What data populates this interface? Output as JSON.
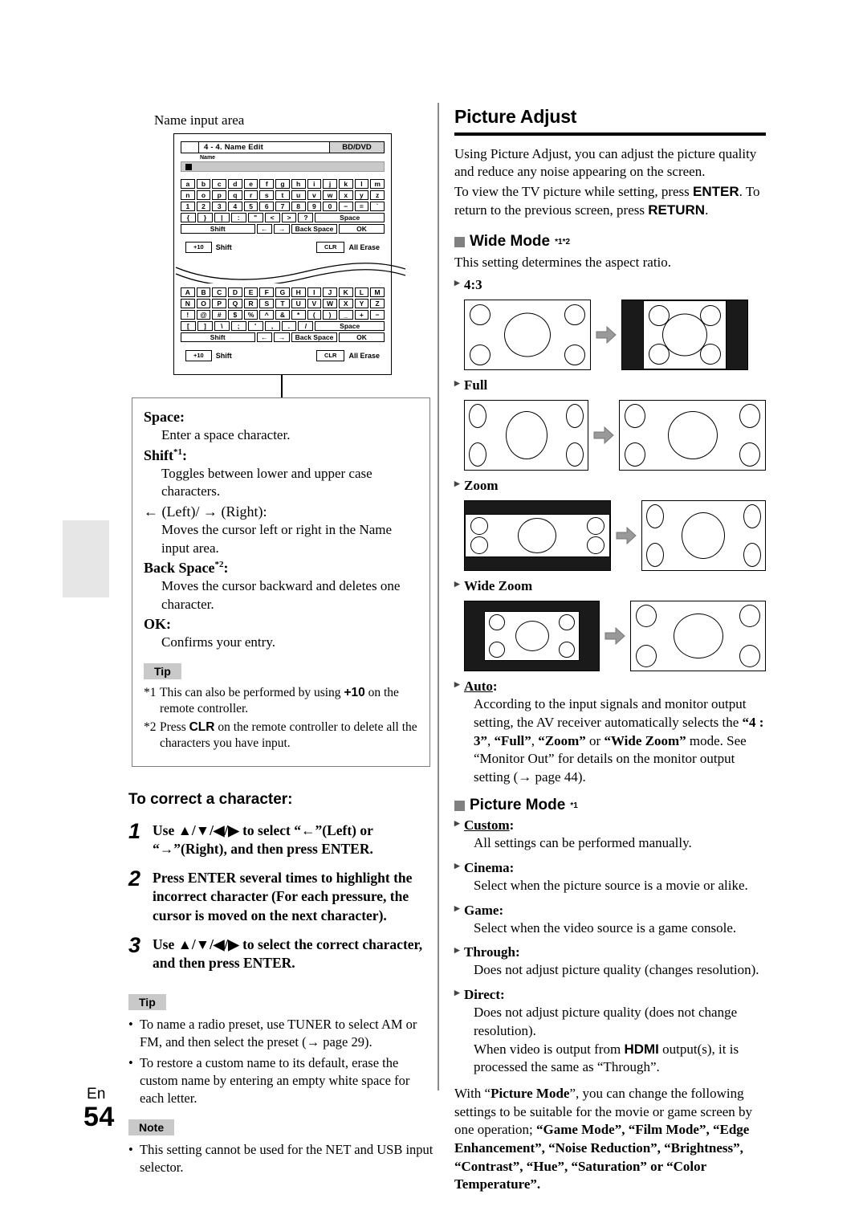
{
  "footer": {
    "lang": "En",
    "page": "54"
  },
  "left": {
    "caption": "Name input area",
    "osd": {
      "title": "4 - 4. Name  Edit",
      "tag": "BD/DVD",
      "name_label": "Name"
    },
    "keyboard_lower": {
      "rows": [
        [
          "a",
          "b",
          "c",
          "d",
          "e",
          "f",
          "g",
          "h",
          "i",
          "j",
          "k",
          "l",
          "m"
        ],
        [
          "n",
          "o",
          "p",
          "q",
          "r",
          "s",
          "t",
          "u",
          "v",
          "w",
          "x",
          "y",
          "z"
        ],
        [
          "1",
          "2",
          "3",
          "4",
          "5",
          "6",
          "7",
          "8",
          "9",
          "0",
          "−",
          "=",
          "`"
        ],
        [
          "{",
          "}",
          "|",
          ":",
          "\"",
          "<",
          ">",
          "?"
        ]
      ],
      "space": "Space",
      "shift": "Shift",
      "left_arrow": "←",
      "right_arrow": "→",
      "back_space": "Back Space",
      "ok": "OK"
    },
    "keyboard_upper": {
      "rows": [
        [
          "A",
          "B",
          "C",
          "D",
          "E",
          "F",
          "G",
          "H",
          "I",
          "J",
          "K",
          "L",
          "M"
        ],
        [
          "N",
          "O",
          "P",
          "Q",
          "R",
          "S",
          "T",
          "U",
          "V",
          "W",
          "X",
          "Y",
          "Z"
        ],
        [
          "!",
          "@",
          "#",
          "$",
          "%",
          "^",
          "&",
          "*",
          "(",
          ")",
          "_",
          "+",
          "−"
        ],
        [
          "[",
          "]",
          "\\",
          ";",
          "'",
          ",",
          ".",
          "/"
        ]
      ],
      "space": "Space",
      "shift": "Shift",
      "left_arrow": "←",
      "right_arrow": "→",
      "back_space": "Back Space",
      "ok": "OK"
    },
    "legend": {
      "plus10": "+10",
      "plus10_label": "Shift",
      "clr": "CLR",
      "clr_label": "All Erase"
    },
    "definitions": {
      "space_term": "Space",
      "space_def": "Enter a space character.",
      "shift_term": "Shift",
      "shift_sup": "*1",
      "shift_def": "Toggles between lower and upper case characters.",
      "arrows_term": "← (Left)/ → (Right):",
      "arrows_def": "Moves the cursor left or right in the Name input area.",
      "back_term": "Back Space",
      "back_sup": "*2",
      "back_def": "Moves the cursor backward and deletes one character.",
      "ok_term": "OK",
      "ok_def": "Confirms your entry."
    },
    "tip_box": {
      "label": "Tip",
      "fn1_mark": "*1",
      "fn1_a": "This can also be performed by using ",
      "fn1_key": "+10",
      "fn1_b": " on the remote controller.",
      "fn2_mark": "*2",
      "fn2_a": "Press ",
      "fn2_key": "CLR",
      "fn2_b": " on the remote controller to delete all the characters you have input."
    },
    "correct": {
      "heading": "To correct a character:",
      "steps": [
        {
          "num": "1",
          "text": "Use ▲/▼/◀/▶ to select “←”(Left) or “→”(Right), and then press ENTER."
        },
        {
          "num": "2",
          "text": "Press ENTER several times to highlight the incorrect character (For each pressure, the cursor is moved on the next character)."
        },
        {
          "num": "3",
          "text": "Use ▲/▼/◀/▶ to select the correct character, and then press ENTER."
        }
      ]
    },
    "tip2": {
      "label": "Tip",
      "items": [
        "To name a radio preset, use TUNER to select AM or FM, and then select the preset (→ page 29).",
        "To restore a custom name to its default, erase the custom name by entering an empty white space for each letter."
      ]
    },
    "note": {
      "label": "Note",
      "items": [
        "This setting cannot be used for the NET and USB input selector."
      ]
    }
  },
  "right": {
    "title": "Picture Adjust",
    "intro_1": "Using Picture Adjust, you can adjust the picture quality and reduce any noise appearing on the screen.",
    "intro_2a": "To view the TV picture while setting, press ",
    "intro_2b": "ENTER",
    "intro_2c": ". To return to the previous screen, press ",
    "intro_2d": "RETURN",
    "intro_2e": ".",
    "wide_mode": {
      "label": "Wide Mode",
      "sup": "*1*2",
      "desc": "This setting determines the aspect ratio."
    },
    "modes": [
      {
        "label": "4:3",
        "diagram": "four-three"
      },
      {
        "label": "Full",
        "diagram": "full"
      },
      {
        "label": "Zoom",
        "diagram": "zoom"
      },
      {
        "label": "Wide Zoom",
        "diagram": "wide-zoom"
      }
    ],
    "auto": {
      "term": "Auto",
      "line1": "According to the input signals and monitor output setting, the AV receiver automatically selects the ",
      "q1": "“4 : 3”",
      "q2": "“Full”",
      "q3": "“Zoom”",
      "q4": "“Wide Zoom”",
      "line2": " mode. See “Monitor Out” for details on the monitor output setting (→ page 44)."
    },
    "picture_mode": {
      "label": "Picture Mode",
      "sup": "*1"
    },
    "picture_modes": [
      {
        "term": "Custom",
        "underline": true,
        "def": "All settings can be performed manually."
      },
      {
        "term": "Cinema",
        "underline": false,
        "def": "Select when the picture source is a movie or alike."
      },
      {
        "term": "Game",
        "underline": false,
        "def": "Select when the video source is a game console."
      },
      {
        "term": "Through",
        "underline": false,
        "def": "Does not adjust picture quality (changes resolution)."
      },
      {
        "term": "Direct",
        "underline": false,
        "def": "Does not adjust picture quality (does not change resolution)."
      }
    ],
    "direct_extra_a": "When video is output from ",
    "direct_extra_b": "HDMI",
    "direct_extra_c": " output(s), it is processed the same as “Through”.",
    "tail": {
      "a": "With “",
      "pm": "Picture Mode",
      "b": "”, you can change the following settings to be suitable for the movie or game screen by one operation; ",
      "terms": [
        "“Game Mode”",
        "“Film Mode”",
        "“Edge Enhancement”",
        "“Noise Reduction”",
        "“Brightness”",
        "“Contrast”",
        "“Hue”",
        "“Saturation”",
        "“Color Temperature”"
      ]
    }
  }
}
